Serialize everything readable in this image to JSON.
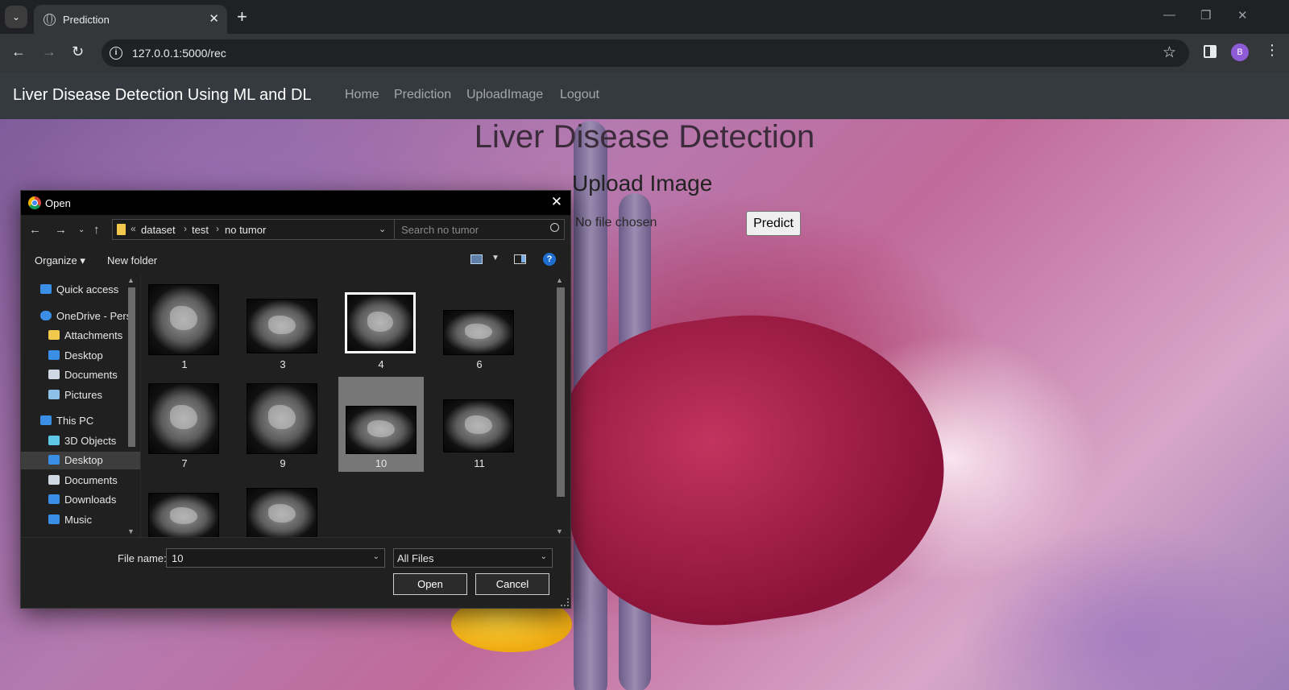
{
  "browser": {
    "tab_title": "Prediction",
    "url": "127.0.0.1:5000/rec",
    "profile_initial": "B"
  },
  "site": {
    "brand": "Liver Disease Detection Using ML and DL",
    "nav": [
      "Home",
      "Prediction",
      "UploadImage",
      "Logout"
    ],
    "heading": "Liver Disease Detection",
    "subheading": "Upload Image",
    "file_status": "No file chosen",
    "predict_label": "Predict"
  },
  "dialog": {
    "title": "Open",
    "breadcrumb": [
      "dataset",
      "test",
      "no tumor"
    ],
    "search_placeholder": "Search no tumor",
    "organize_label": "Organize",
    "new_folder_label": "New folder",
    "nav_items": [
      {
        "label": "Quick access",
        "icon": "star-icon",
        "color": "#3a8ee6"
      },
      {
        "label": "OneDrive - Pers",
        "icon": "cloud-icon",
        "color": "#3a8ee6"
      },
      {
        "label": "Attachments",
        "icon": "folder-icon",
        "color": "#f2c94c"
      },
      {
        "label": "Desktop",
        "icon": "desktop-icon",
        "color": "#3a8ee6"
      },
      {
        "label": "Documents",
        "icon": "documents-icon",
        "color": "#cfd8e3"
      },
      {
        "label": "Pictures",
        "icon": "pictures-icon",
        "color": "#8ec1e8"
      },
      {
        "label": "This PC",
        "icon": "computer-icon",
        "color": "#3a8ee6"
      },
      {
        "label": "3D Objects",
        "icon": "cube-icon",
        "color": "#5fc7e8"
      },
      {
        "label": "Desktop",
        "icon": "desktop-icon",
        "color": "#3a8ee6",
        "selected": true
      },
      {
        "label": "Documents",
        "icon": "documents-icon",
        "color": "#cfd8e3"
      },
      {
        "label": "Downloads",
        "icon": "download-icon",
        "color": "#3a8ee6"
      },
      {
        "label": "Music",
        "icon": "music-icon",
        "color": "#3a8ee6"
      }
    ],
    "files": [
      {
        "name": "1"
      },
      {
        "name": "3"
      },
      {
        "name": "4"
      },
      {
        "name": "6"
      },
      {
        "name": "7"
      },
      {
        "name": "9"
      },
      {
        "name": "10",
        "selected": true
      },
      {
        "name": "11"
      },
      {
        "name": ""
      },
      {
        "name": ""
      }
    ],
    "filename_label": "File name:",
    "filename_value": "10",
    "filetype": "All Files",
    "open_label": "Open",
    "cancel_label": "Cancel"
  }
}
